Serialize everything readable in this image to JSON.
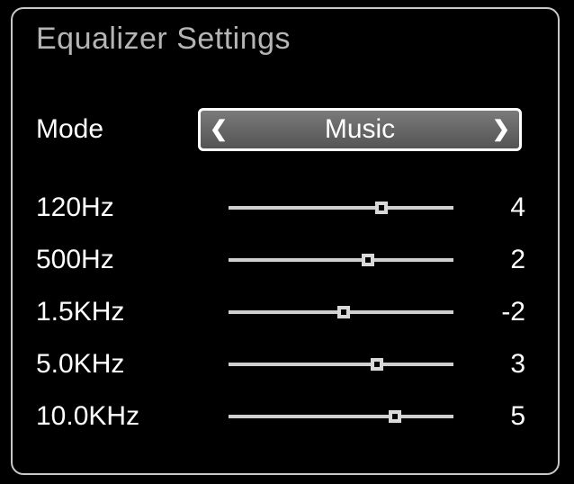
{
  "title": "Equalizer Settings",
  "mode": {
    "label": "Mode",
    "value": "Music"
  },
  "bands": [
    {
      "label": "120Hz",
      "value": "4",
      "thumb_percent": 68
    },
    {
      "label": "500Hz",
      "value": "2",
      "thumb_percent": 62
    },
    {
      "label": "1.5KHz",
      "value": "-2",
      "thumb_percent": 51
    },
    {
      "label": "5.0KHz",
      "value": "3",
      "thumb_percent": 66
    },
    {
      "label": "10.0KHz",
      "value": "5",
      "thumb_percent": 74
    }
  ]
}
